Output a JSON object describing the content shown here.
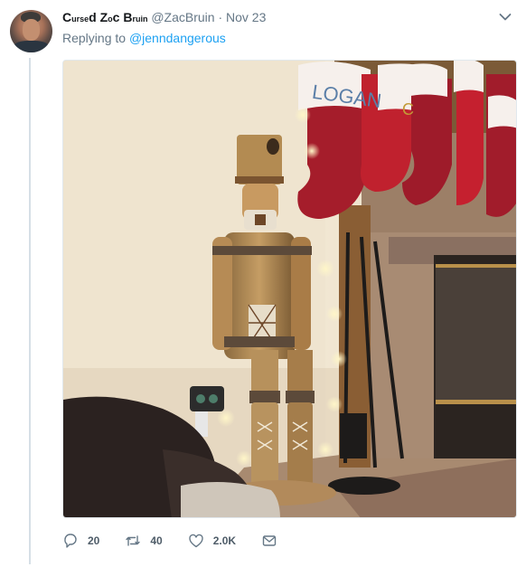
{
  "tweet": {
    "display_name_parts": [
      "C",
      "urse",
      "d Z",
      "o",
      "c B",
      "ruin"
    ],
    "handle": "@ZacBruin",
    "separator": "·",
    "date": "Nov 23",
    "replying_prefix": "Replying to",
    "replying_to": "@jenndangerous",
    "media": {
      "stocking_text_left": "LOGAN",
      "stocking_text_right": "C"
    },
    "actions": {
      "reply_count": "20",
      "retweet_count": "40",
      "like_count": "2.0K"
    },
    "icons": [
      "chevron-down-icon",
      "reply-icon",
      "retweet-icon",
      "heart-icon",
      "message-icon"
    ]
  }
}
